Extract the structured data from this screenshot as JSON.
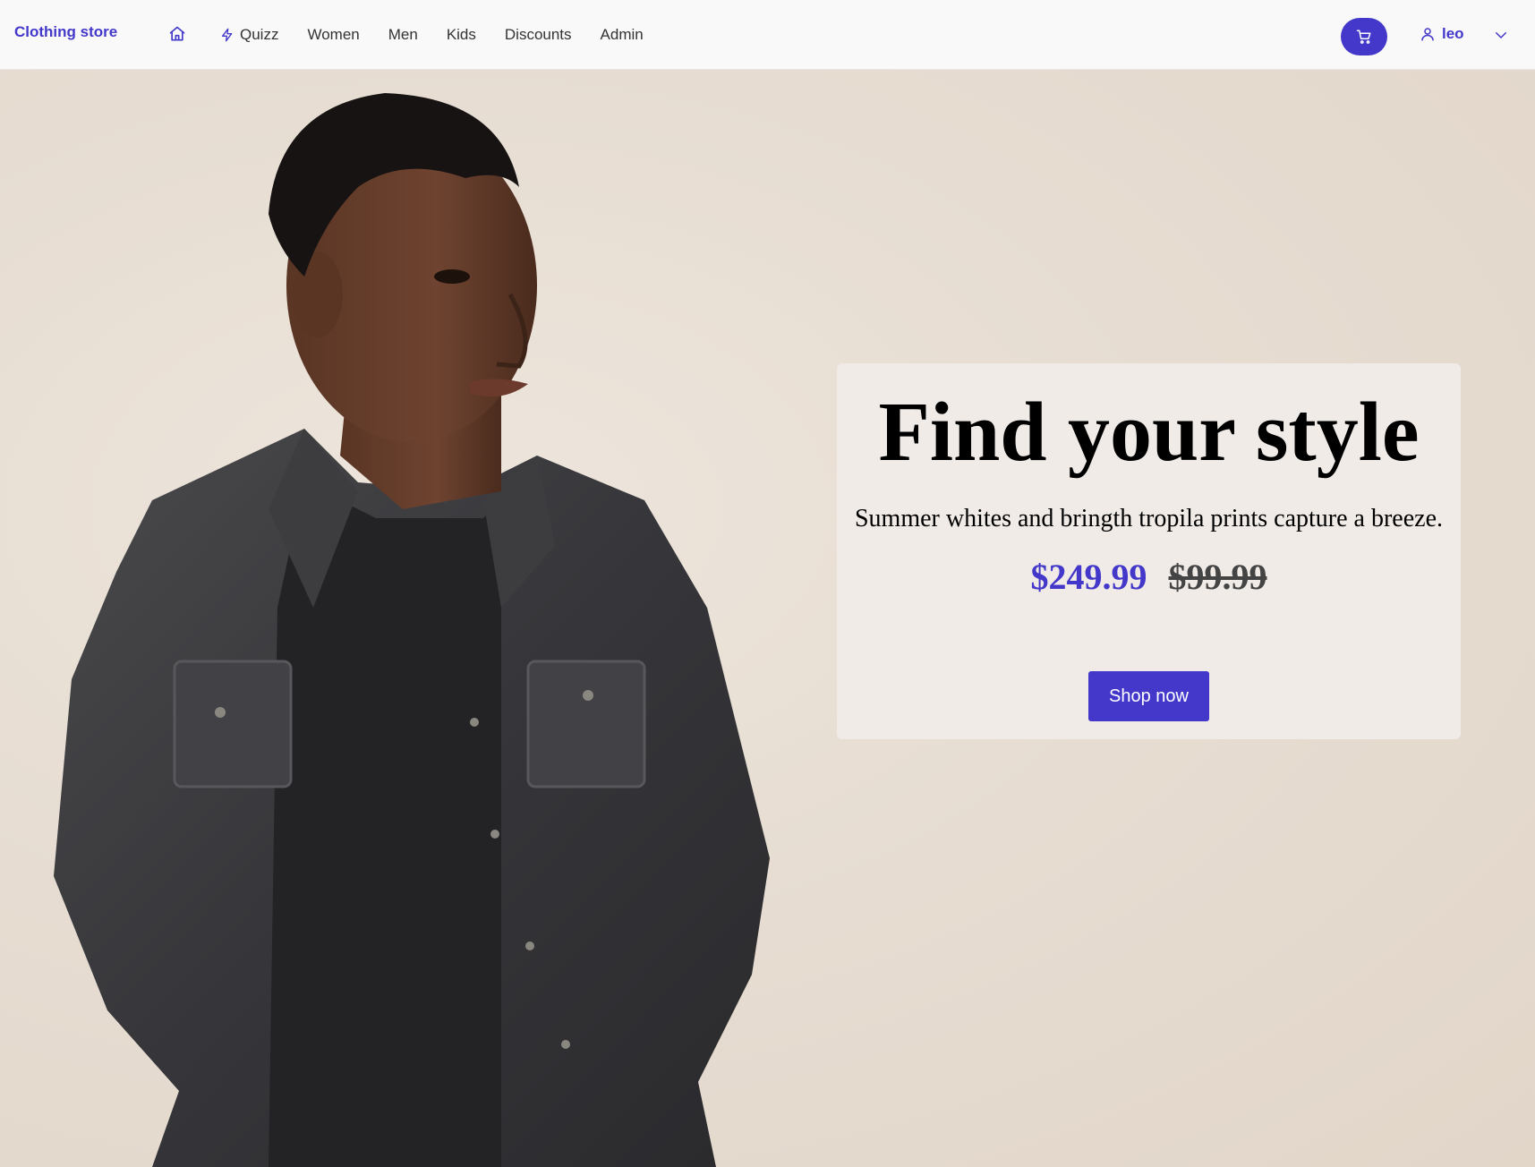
{
  "navbar": {
    "brand": "Clothing store",
    "links": [
      {
        "label": "Quizz",
        "icon": "bolt-icon"
      },
      {
        "label": "Women"
      },
      {
        "label": "Men"
      },
      {
        "label": "Kids"
      },
      {
        "label": "Discounts"
      },
      {
        "label": "Admin"
      }
    ],
    "user_name": "leo",
    "accent_color": "#4338ca"
  },
  "hero": {
    "title": "Find your style",
    "subtitle": "Summer whites and bringth tropila prints capture a breeze.",
    "price_current": "$249.99",
    "price_original": "$99.99",
    "cta_label": "Shop now"
  }
}
